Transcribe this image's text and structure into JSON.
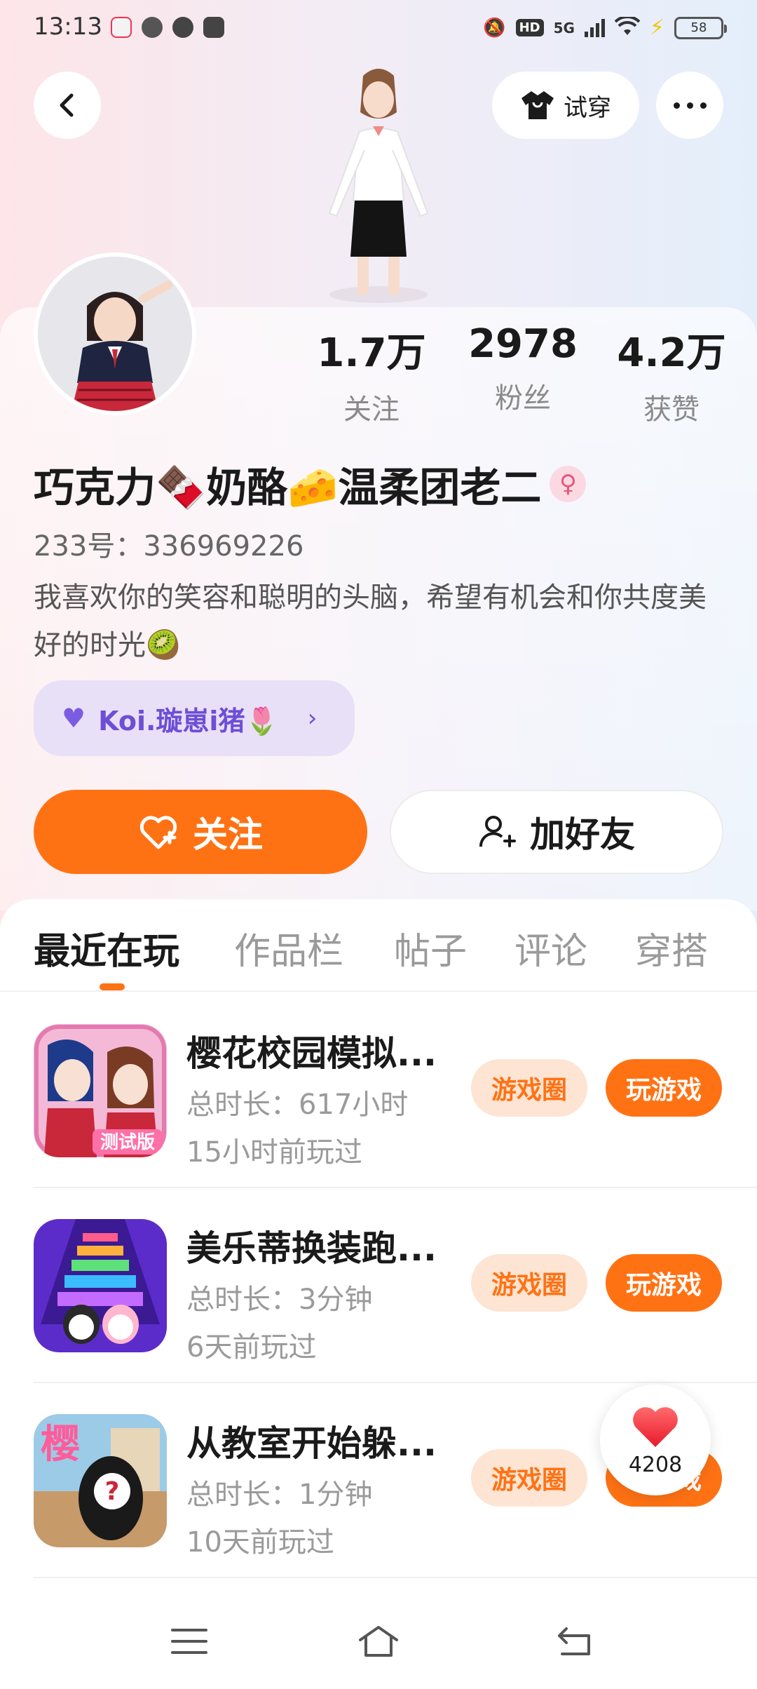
{
  "status_bar": {
    "time": "13:13",
    "network": "5G",
    "hd": "HD",
    "battery": "58"
  },
  "header": {
    "tryon_label": "试穿"
  },
  "profile": {
    "nickname": "巧克力🍫奶酪🧀温柔团老二",
    "gender_symbol": "♀",
    "uid": "233号：336969226",
    "bio": "我喜欢你的笑容和聪明的头脑，希望有机会和你共度美好的时光🥝",
    "relation_name": "Koi.璇崽i猪🌷",
    "stats": [
      {
        "value": "1.7万",
        "label": "关注"
      },
      {
        "value": "2978",
        "label": "粉丝"
      },
      {
        "value": "4.2万",
        "label": "获赞"
      }
    ]
  },
  "actions": {
    "follow_label": "关注",
    "add_friend_label": "加好友"
  },
  "tabs": [
    "最近在玩",
    "作品栏",
    "帖子",
    "评论",
    "穿搭"
  ],
  "games": [
    {
      "title": "樱花校园模拟...",
      "duration": "总时长：617小时",
      "last_played": "15小时前玩过",
      "circle_label": "游戏圈",
      "play_label": "玩游戏",
      "icon_badge": "测试版"
    },
    {
      "title": "美乐蒂换装跑...",
      "duration": "总时长：3分钟",
      "last_played": "6天前玩过",
      "circle_label": "游戏圈",
      "play_label": "玩游戏"
    },
    {
      "title": "从教室开始躲...",
      "duration": "总时长：1分钟",
      "last_played": "10天前玩过",
      "circle_label": "游戏圈",
      "play_label": "玩游戏",
      "icon_badge": "樱"
    }
  ],
  "like_float": {
    "count": "4208"
  },
  "colors": {
    "accent": "#ff7214",
    "relation": "#6b4fd6"
  }
}
